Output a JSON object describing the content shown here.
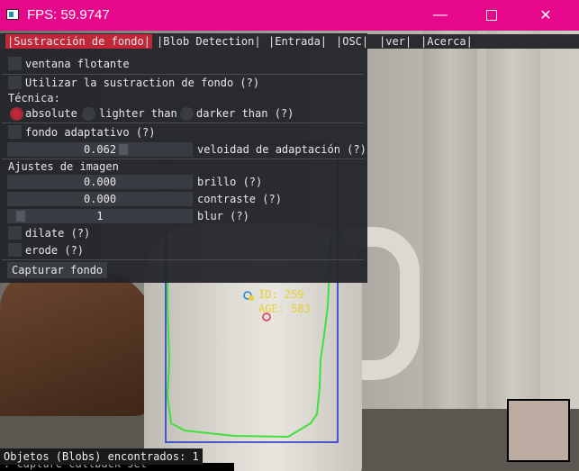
{
  "window": {
    "title": "FPS: 59.9747",
    "minimize_glyph": "—",
    "close_glyph": "✕"
  },
  "menu": [
    "|Sustracción de fondo|",
    "|Blob Detection|",
    "|Entrada|",
    "|OSC|",
    "|ver|",
    "|Acerca|"
  ],
  "panel": {
    "floating_window": "ventana flotante",
    "use_bg_sub": "Utilizar la sustraction de fondo (?)",
    "technique_label": "Técnica:",
    "techniques": [
      "absolute",
      "lighter than",
      "darker than (?)"
    ],
    "technique_selected": "absolute",
    "adaptive_bg": "fondo adaptativo (?)",
    "adapt_speed_value": "0.062",
    "adapt_speed_label": "veloidad de adaptación (?)",
    "image_settings": "Ajustes de imagen",
    "brightness_value": "0.000",
    "brightness_label": "brillo (?)",
    "contrast_value": "0.000",
    "contrast_label": "contraste (?)",
    "blur_value": "1",
    "blur_label": "blur (?)",
    "dilate_label": "dilate (?)",
    "erode_label": "erode (?)",
    "capture_button": "Capturar fondo"
  },
  "blob": {
    "id_text": "ID: 259",
    "age_text": "AGE: 583"
  },
  "status": {
    "blob_count_text": "Objetos (Blobs) encontrados: 1",
    "log_line": ": capture callback set"
  },
  "colors": {
    "titlebar": "#e6078a",
    "accent": "#c0283a",
    "blob_text": "#e8d230",
    "contour": "#3ee03a",
    "bbox": "#1a2fd0"
  }
}
